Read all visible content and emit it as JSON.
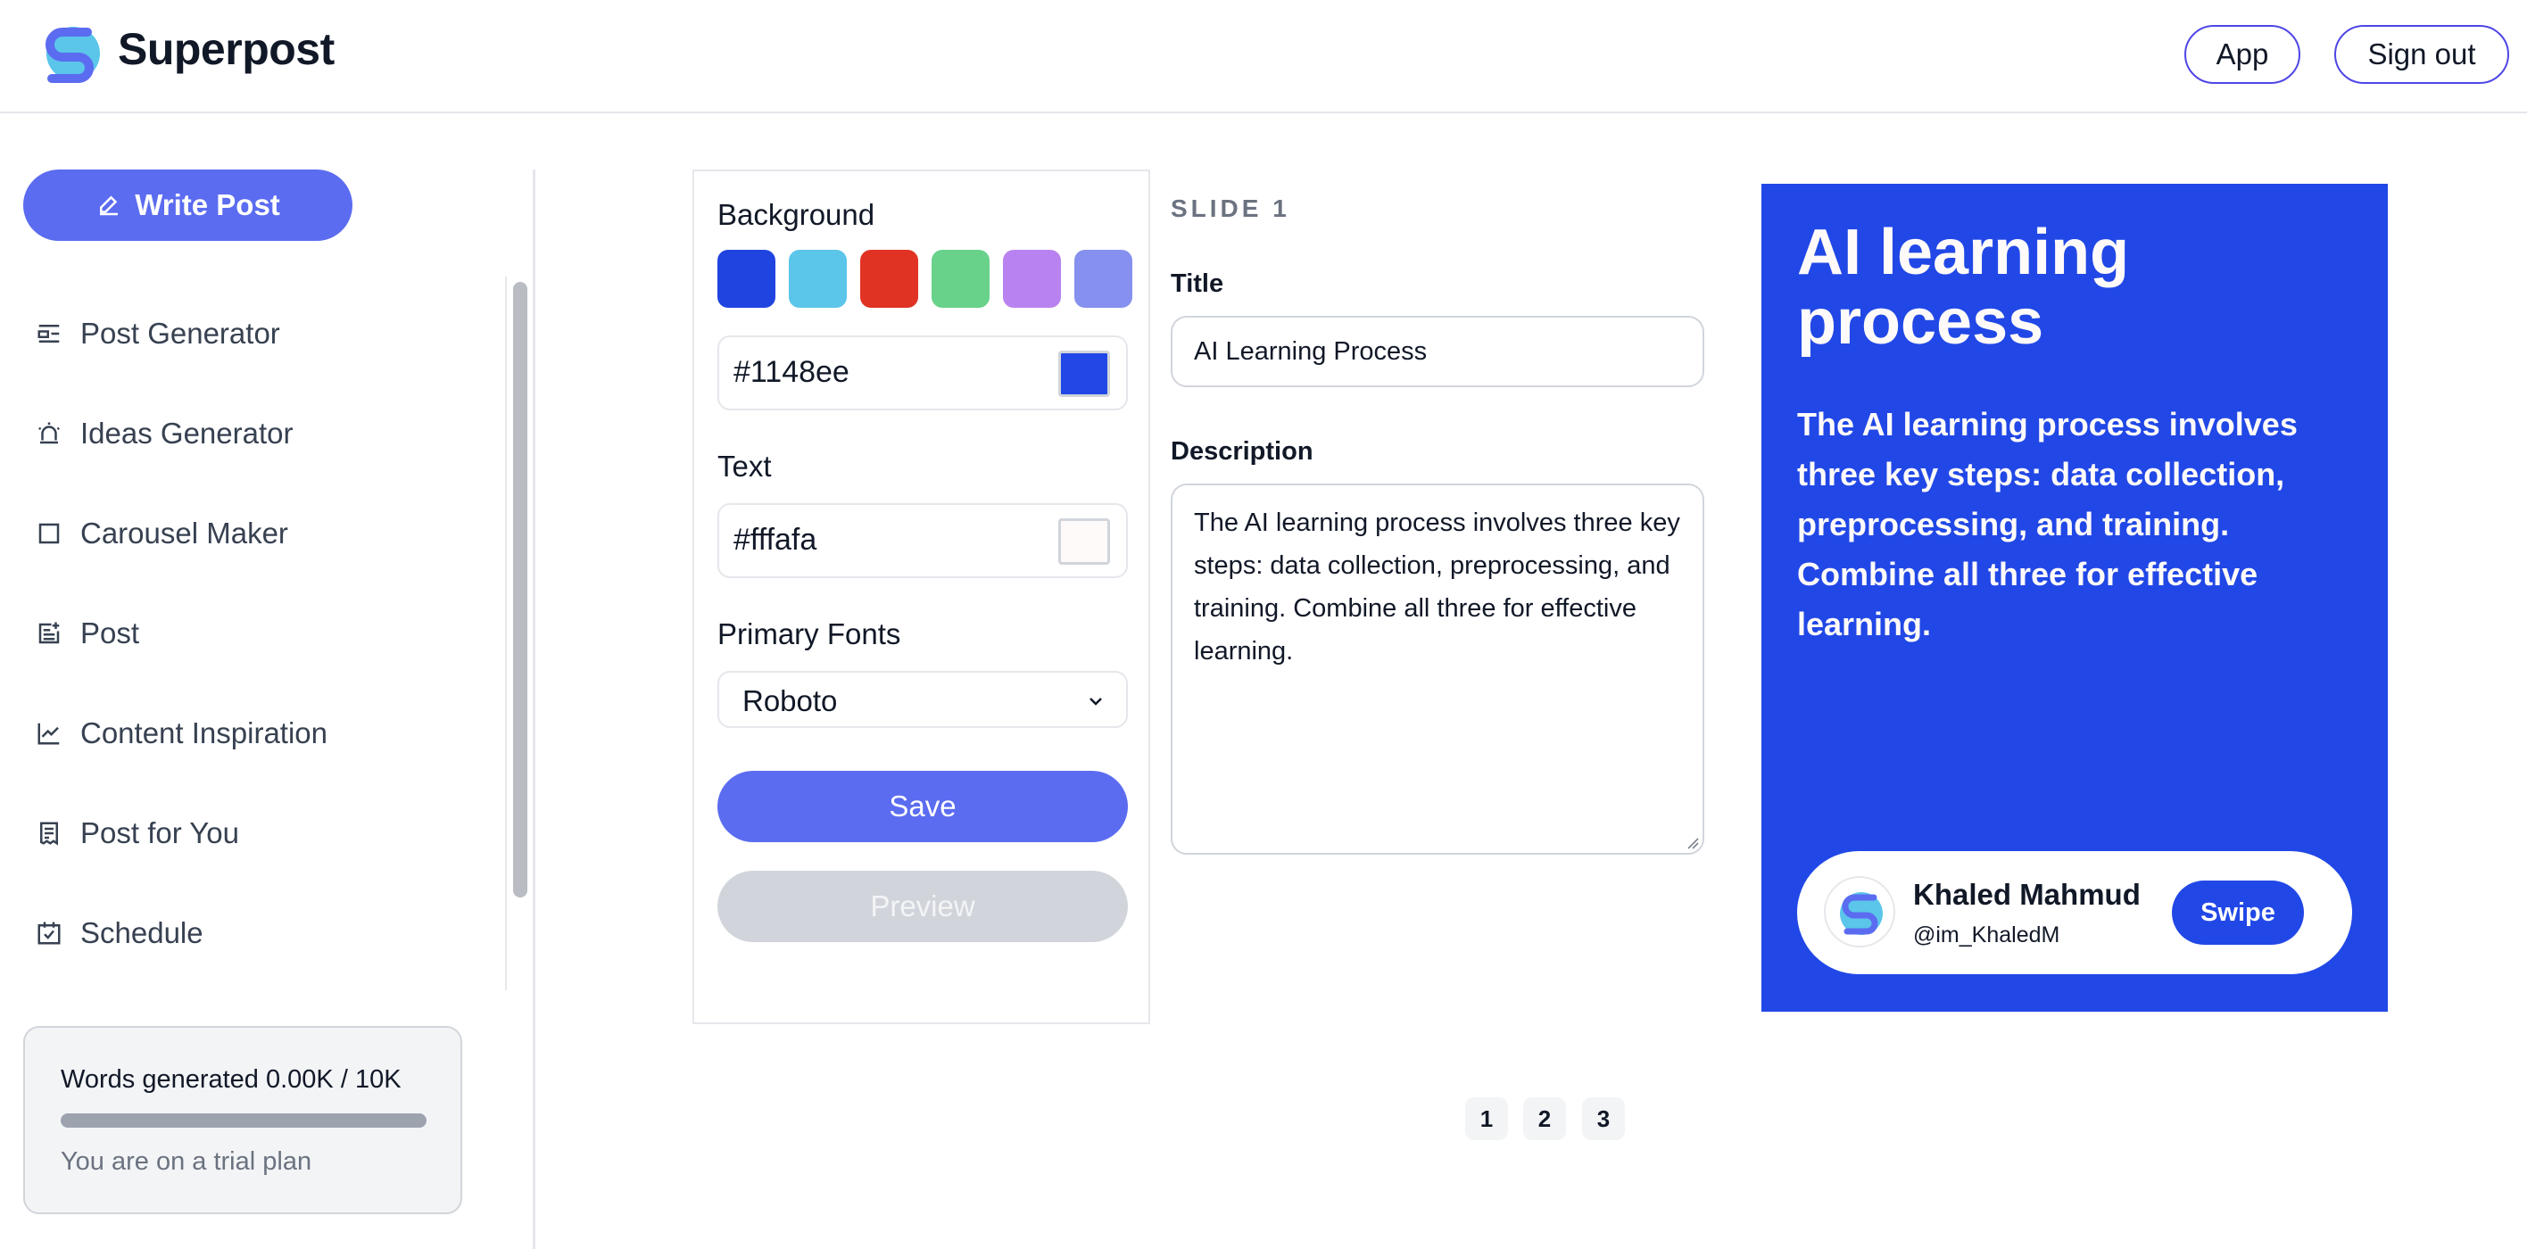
{
  "header": {
    "brand": "Superpost",
    "app_label": "App",
    "signout_label": "Sign out"
  },
  "sidebar": {
    "write_label": "Write Post",
    "items": [
      {
        "label": "Post Generator",
        "icon": "post-generator-icon"
      },
      {
        "label": "Ideas Generator",
        "icon": "alarm-light-icon"
      },
      {
        "label": "Carousel Maker",
        "icon": "square-icon"
      },
      {
        "label": "Post",
        "icon": "post-add-icon"
      },
      {
        "label": "Content Inspiration",
        "icon": "line-chart-icon"
      },
      {
        "label": "Post for You",
        "icon": "receipt-icon"
      },
      {
        "label": "Schedule",
        "icon": "calendar-check-icon"
      }
    ],
    "usage": {
      "text": "Words generated 0.00K / 10K",
      "progress": 0,
      "trial": "You are on a trial plan"
    }
  },
  "settings": {
    "background_label": "Background",
    "swatches": [
      "#1f44e0",
      "#5bc5ea",
      "#e03324",
      "#68d28b",
      "#b883f0",
      "#8690ee"
    ],
    "background_value": "#1148ee",
    "text_label": "Text",
    "text_value": "#fffafa",
    "fonts_label": "Primary Fonts",
    "font_value": "Roboto",
    "save_label": "Save",
    "preview_label": "Preview"
  },
  "editor": {
    "slide_label": "SLIDE 1",
    "title_label": "Title",
    "title_value": "AI Learning Process",
    "description_label": "Description",
    "description_value": "The AI learning process involves three key steps: data collection, preprocessing, and training. Combine all three for effective learning."
  },
  "slide": {
    "title": "AI learning process",
    "description": "The AI learning process involves three key steps: data collection, preprocessing, and training. Combine all three for effective learning.",
    "author_name": "Khaled Mahmud",
    "author_handle": "@im_KhaledM",
    "swipe_label": "Swipe",
    "bg_color": "#2148e6",
    "text_color": "#fffafa"
  },
  "pagination": [
    "1",
    "2",
    "3"
  ]
}
